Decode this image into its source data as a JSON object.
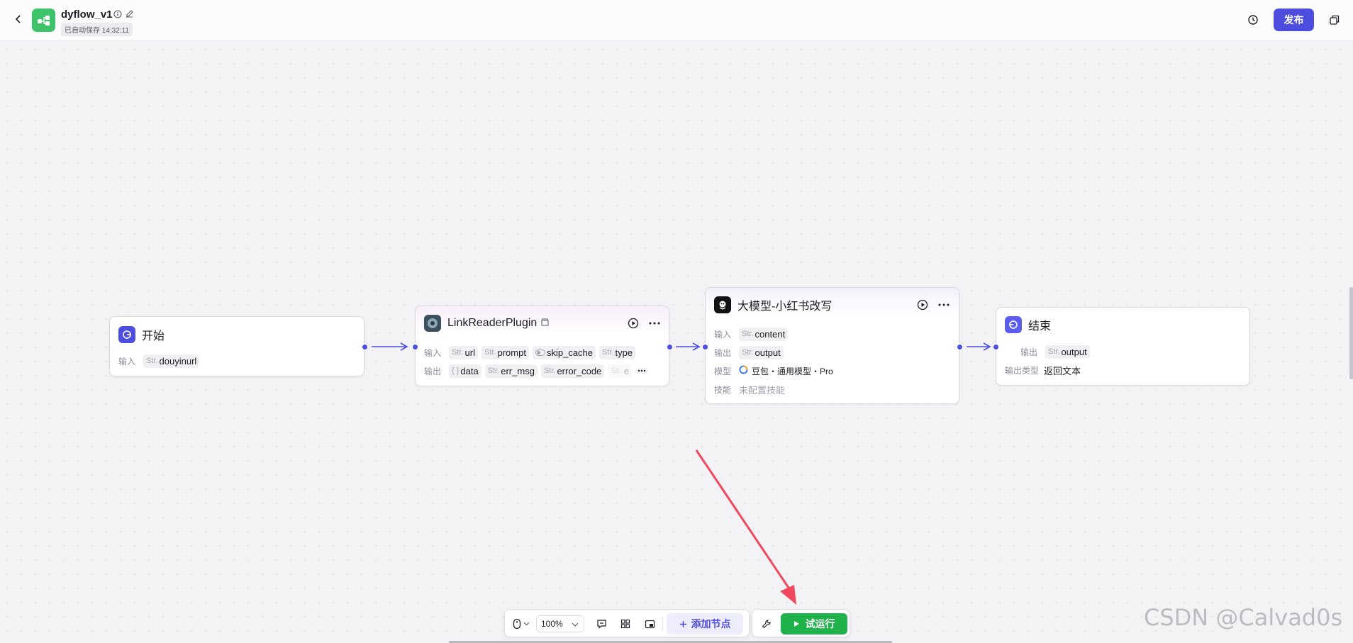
{
  "header": {
    "title": "dyflow_v1",
    "autosave": "已自动保存 14:32:11",
    "publish_label": "发布"
  },
  "nodes": {
    "start": {
      "title": "开始",
      "input_label": "输入",
      "inputs": [
        {
          "type": "Str.",
          "name": "douyinurl"
        }
      ]
    },
    "link_reader": {
      "title": "LinkReaderPlugin",
      "input_label": "输入",
      "output_label": "输出",
      "inputs": [
        {
          "type": "Str.",
          "name": "url"
        },
        {
          "type": "Str.",
          "name": "prompt"
        },
        {
          "type": "",
          "name": "skip_cache"
        },
        {
          "type": "Str.",
          "name": "type"
        }
      ],
      "outputs": [
        {
          "type": "{ }",
          "name": "data"
        },
        {
          "type": "Str.",
          "name": "err_msg"
        },
        {
          "type": "Str.",
          "name": "error_code"
        },
        {
          "type": "Str.",
          "name": "e"
        }
      ]
    },
    "llm": {
      "title": "大模型-小红书改写",
      "input_label": "输入",
      "output_label": "输出",
      "model_label": "模型",
      "skill_label": "技能",
      "inputs": [
        {
          "type": "Str.",
          "name": "content"
        }
      ],
      "outputs": [
        {
          "type": "Str.",
          "name": "output"
        }
      ],
      "model_value": "豆包・通用模型・Pro",
      "skill_value": "未配置技能"
    },
    "end": {
      "title": "结束",
      "output_label": "输出",
      "output_type_label": "输出类型",
      "outputs": [
        {
          "type": "Str.",
          "name": "output"
        }
      ],
      "output_type_value": "返回文本"
    }
  },
  "toolbar": {
    "zoom": "100%",
    "add_node_label": "添加节点",
    "run_label": "试运行"
  },
  "watermark": "CSDN @Calvad0s",
  "colors": {
    "accent": "#4d4ee0",
    "run": "#1fb14a",
    "app_icon": "#3ec26a",
    "annotation_arrow": "#f0485e"
  }
}
